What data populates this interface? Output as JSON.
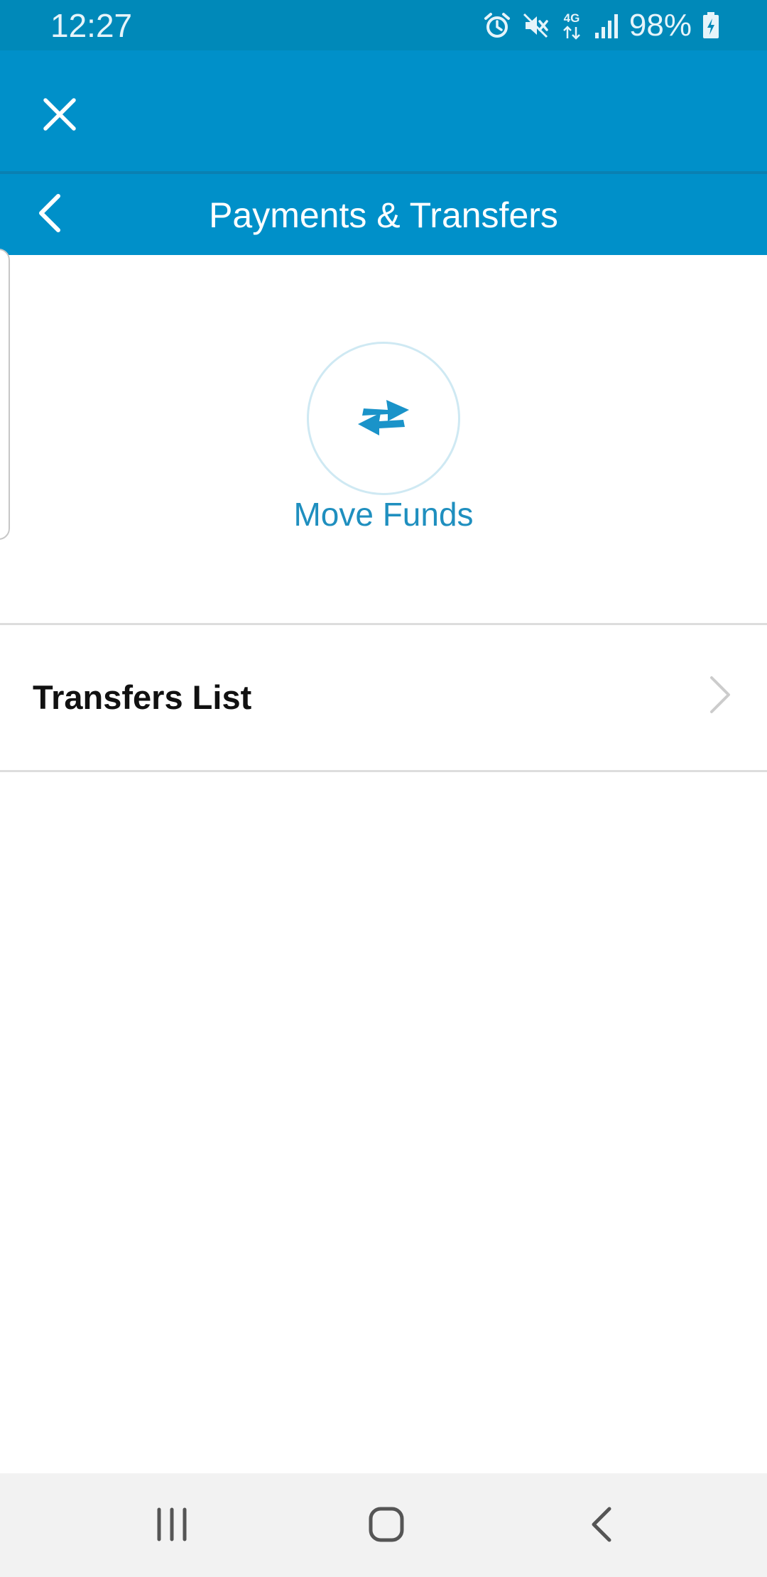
{
  "status_bar": {
    "time": "12:27",
    "network_type": "4G",
    "battery": "98%",
    "icons": [
      "alarm-icon",
      "mute-icon",
      "4g-data-icon",
      "signal-icon",
      "battery-charging-icon"
    ]
  },
  "top_bar": {
    "close_icon": "close-icon"
  },
  "title_bar": {
    "title": "Payments & Transfers",
    "back_icon": "chevron-left-icon"
  },
  "move_funds": {
    "label": "Move Funds",
    "icon": "swap-arrows-icon"
  },
  "transfers_row": {
    "label": "Transfers List",
    "icon": "chevron-right-icon"
  },
  "nav_bar": {
    "icons": [
      "recent-apps-icon",
      "home-icon",
      "back-icon"
    ]
  },
  "colors": {
    "status_bar": "#0089b9",
    "app_bar": "#0090c9",
    "accent": "#1f8fbf",
    "nav_bar": "#f2f2f2"
  }
}
